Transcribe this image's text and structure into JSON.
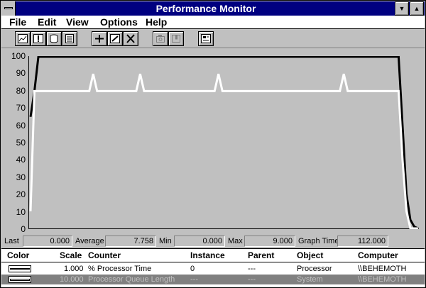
{
  "window": {
    "title": "Performance Monitor"
  },
  "menu": [
    "File",
    "Edit",
    "View",
    "Options",
    "Help"
  ],
  "toolbar": [
    {
      "name": "chart-view-button",
      "icon": "chart-icon",
      "enabled": true
    },
    {
      "name": "alert-view-button",
      "icon": "alert-icon",
      "enabled": true
    },
    {
      "name": "log-view-button",
      "icon": "log-cylinder-icon",
      "enabled": true
    },
    {
      "name": "report-view-button",
      "icon": "report-icon",
      "enabled": true
    },
    {
      "name": "add-counter-button",
      "icon": "plus-icon",
      "enabled": true
    },
    {
      "name": "edit-counter-button",
      "icon": "edit-icon",
      "enabled": true
    },
    {
      "name": "delete-counter-button",
      "icon": "delete-x-icon",
      "enabled": true
    },
    {
      "name": "update-now-button",
      "icon": "camera-icon",
      "enabled": false
    },
    {
      "name": "bookmark-button",
      "icon": "bookmark-icon",
      "enabled": false
    },
    {
      "name": "options-button",
      "icon": "options-icon",
      "enabled": true
    }
  ],
  "values": {
    "last_label": "Last",
    "last": "0.000",
    "average_label": "Average",
    "average": "7.758",
    "min_label": "Min",
    "min": "0.000",
    "max_label": "Max",
    "max": "9.000",
    "graph_time_label": "Graph Time",
    "graph_time": "112.000"
  },
  "legend": {
    "headers": [
      "Color",
      "Scale",
      "Counter",
      "Instance",
      "Parent",
      "Object",
      "Computer"
    ],
    "rows": [
      {
        "color": "#000000",
        "scale": "1.000",
        "counter": "% Processor Time",
        "instance": "0",
        "parent": "---",
        "object": "Processor",
        "computer": "\\\\BEHEMOTH",
        "selected": false
      },
      {
        "color": "#ffffff",
        "scale": "10.000",
        "counter": "Processor Queue Length",
        "instance": "---",
        "parent": "---",
        "object": "System",
        "computer": "\\\\BEHEMOTH",
        "selected": true
      }
    ]
  },
  "chart_data": {
    "type": "line",
    "ylim": [
      0,
      100
    ],
    "yticks": [
      "100",
      "90",
      "80",
      "70",
      "60",
      "50",
      "40",
      "30",
      "20",
      "10",
      "0"
    ],
    "grid": false,
    "x": [
      0,
      1,
      2,
      3,
      4,
      5,
      6,
      7,
      8,
      9,
      10,
      11,
      12,
      13,
      14,
      15,
      16,
      17,
      18,
      19,
      20,
      21,
      22,
      23,
      24,
      25,
      26,
      27,
      28,
      29,
      30,
      31,
      32,
      33,
      34,
      35,
      36,
      37,
      38,
      39,
      40,
      41,
      42,
      43,
      44,
      45,
      46,
      47,
      48,
      49,
      50,
      51,
      52,
      53,
      54,
      55,
      56,
      57,
      58,
      59,
      60,
      61,
      62,
      63,
      64,
      65,
      66,
      67,
      68,
      69,
      70,
      71,
      72,
      73,
      74,
      75,
      76,
      77,
      78,
      79,
      80,
      81,
      82,
      83,
      84,
      85,
      86,
      87,
      88,
      89,
      90,
      91,
      92,
      93,
      94,
      95,
      96,
      97,
      98,
      99
    ],
    "series": [
      {
        "color": "#000000",
        "values": [
          65,
          80,
          100,
          100,
          100,
          100,
          100,
          100,
          100,
          100,
          100,
          100,
          100,
          100,
          100,
          100,
          100,
          100,
          100,
          100,
          100,
          100,
          100,
          100,
          100,
          100,
          100,
          100,
          100,
          100,
          100,
          100,
          100,
          100,
          100,
          100,
          100,
          100,
          100,
          100,
          100,
          100,
          100,
          100,
          100,
          100,
          100,
          100,
          100,
          100,
          100,
          100,
          100,
          100,
          100,
          100,
          100,
          100,
          100,
          100,
          100,
          100,
          100,
          100,
          100,
          100,
          100,
          100,
          100,
          100,
          100,
          100,
          100,
          100,
          100,
          100,
          100,
          100,
          100,
          100,
          100,
          100,
          100,
          100,
          100,
          100,
          100,
          100,
          100,
          100,
          100,
          100,
          100,
          100,
          100,
          60,
          20,
          5,
          1,
          0
        ]
      },
      {
        "color": "#ffffff",
        "values": [
          10,
          80,
          80,
          80,
          80,
          80,
          80,
          80,
          80,
          80,
          80,
          80,
          80,
          80,
          80,
          80,
          90,
          80,
          80,
          80,
          80,
          80,
          80,
          80,
          80,
          80,
          80,
          80,
          90,
          80,
          80,
          80,
          80,
          80,
          80,
          80,
          80,
          80,
          80,
          80,
          80,
          80,
          80,
          80,
          80,
          80,
          80,
          80,
          90,
          80,
          80,
          80,
          80,
          80,
          80,
          80,
          80,
          80,
          80,
          80,
          80,
          80,
          80,
          80,
          80,
          80,
          80,
          80,
          80,
          80,
          80,
          80,
          80,
          80,
          80,
          80,
          80,
          80,
          80,
          80,
          90,
          80,
          80,
          80,
          80,
          80,
          80,
          80,
          80,
          80,
          80,
          80,
          80,
          80,
          80,
          40,
          10,
          0,
          0,
          0
        ]
      }
    ]
  }
}
